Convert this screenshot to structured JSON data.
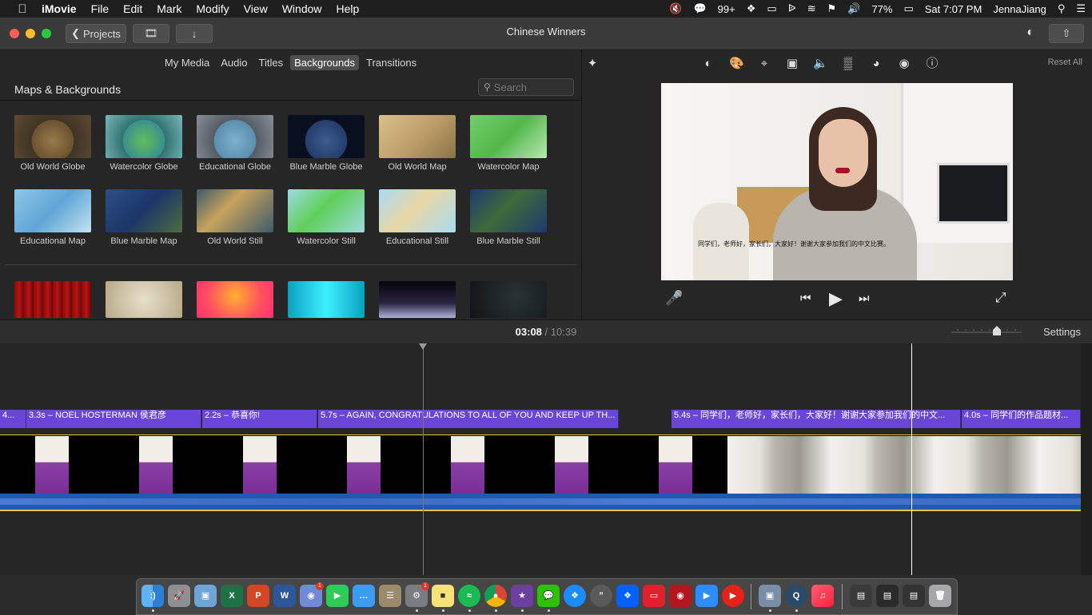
{
  "menubar": {
    "app": "iMovie",
    "items": [
      "File",
      "Edit",
      "Mark",
      "Modify",
      "View",
      "Window",
      "Help"
    ],
    "wechat_count": "99+",
    "battery": "77%",
    "clock": "Sat 7:07 PM",
    "user": "JennaJiang"
  },
  "toolbar": {
    "projects_label": "Projects",
    "window_title": "Chinese Winners"
  },
  "browser": {
    "tabs": [
      "My Media",
      "Audio",
      "Titles",
      "Backgrounds",
      "Transitions"
    ],
    "active_tab": "Backgrounds",
    "section_title": "Maps & Backgrounds",
    "search_placeholder": "Search",
    "items": [
      "Old World Globe",
      "Watercolor Globe",
      "Educational Globe",
      "Blue Marble Globe",
      "Old World Map",
      "Watercolor Map",
      "Educational Map",
      "Blue Marble Map",
      "Old World Still",
      "Watercolor Still",
      "Educational Still",
      "Blue Marble Still"
    ]
  },
  "viewer": {
    "reset_label": "Reset All",
    "subtitle": "同学们，老师好，家长们，大家好！谢谢大家参加我们的中文比赛。"
  },
  "timeline": {
    "current_time": "03:08",
    "separator": "/",
    "total_time": "10:39",
    "settings_label": "Settings",
    "title_clips": [
      "4...",
      "3.3s – NOEL HOSTERMAN 侯君彦",
      "2.2s – 恭喜你!",
      "5.7s – AGAIN, CONGRATULATIONS TO ALL OF YOU AND KEEP UP TH...",
      "5.4s – 同学们，老师好，家长们，大家好！谢谢大家参加我们的中文...",
      "4.0s – 同学们的作品题材..."
    ]
  },
  "dock": {
    "apps": [
      "Finder",
      "Launchpad",
      "Preview",
      "Excel",
      "PowerPoint",
      "Word",
      "Discord",
      "FaceTime",
      "Messages",
      "Notes",
      "System Preferences",
      "Stickies",
      "Spotify",
      "Chrome",
      "iMovie Star",
      "WeChat",
      "Safari",
      "Quotes",
      "Dropbox",
      "Screen",
      "Photo Booth",
      "Zoom",
      "YouTube",
      "Image Capture",
      "QuickTime",
      "Music",
      "Folder A",
      "Folder B",
      "Folder C",
      "Trash"
    ],
    "badges": {
      "discord": "1",
      "system_preferences": "1"
    }
  }
}
